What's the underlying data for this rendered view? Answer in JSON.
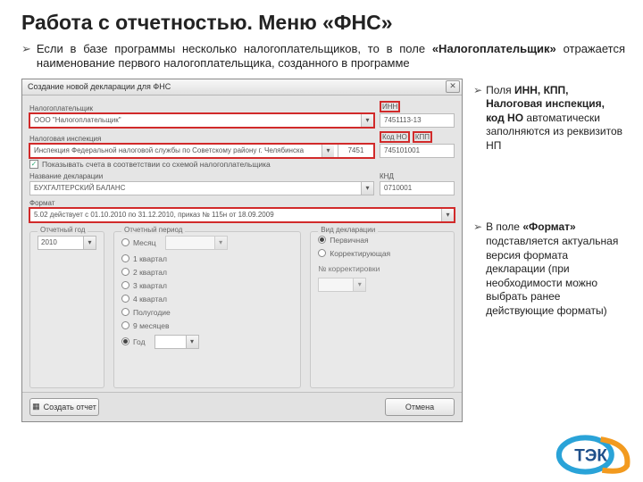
{
  "title": "Работа с отчетностью. Меню «ФНС»",
  "top_bullet_prefix": "Если в базе программы несколько налогоплательщиков, то в поле ",
  "top_bullet_bold": "«Налогоплательщик»",
  "top_bullet_suffix": " отражается наименование первого налогоплательщика, созданного в программе",
  "side": {
    "note1_prefix": "Поля ",
    "note1_bold": "ИНН, КПП, Налоговая инспекция, код НО",
    "note1_suffix": " автоматически заполняются из реквизитов НП",
    "note2_prefix": "В поле ",
    "note2_bold": "«Формат»",
    "note2_suffix": " подставляется актуальная версия формата декларации (при необходимости можно выбрать ранее действующие форматы)"
  },
  "dialog": {
    "title": "Создание новой декларации для ФНС",
    "close": "✕",
    "labels": {
      "taxpayer": "Налогоплательщик",
      "tax_office": "Налоговая инспекция",
      "doc_name": "Название декларации",
      "format": "Формат",
      "inn": "ИНН",
      "code_no": "Код НО",
      "kpp": "КПП",
      "knd": "КНД",
      "report_year": "Отчетный год",
      "report_period": "Отчетный период",
      "decl_kind": "Вид декларации"
    },
    "values": {
      "taxpayer": "ООО \"Налогоплательщик\"",
      "tax_office_combined": "Инспекция Федеральной налоговой службы по Советскому району г. Челябинска",
      "code_no_val": "7451",
      "inn": "7451113-13",
      "kpp": "745101001",
      "doc_name": "БУХГАЛТЕРСКИЙ БАЛАНС",
      "knd": "0710001",
      "format": "5.02 действует с 01.10.2010 по 31.12.2010, приказ № 115н от 18.09.2009",
      "year": "2010"
    },
    "checkbox": "Показывать счета в соответствии со схемой налогоплательщика",
    "periods": [
      "Месяц",
      "1 квартал",
      "2 квартал",
      "3 квартал",
      "4 квартал",
      "Полугодие",
      "9 месяцев",
      "Год"
    ],
    "period_selected": 7,
    "kinds": {
      "primary": "Первичная",
      "correcting": "Корректирующая",
      "corr_num": "№ корректировки"
    },
    "buttons": {
      "create": "Создать отчет",
      "cancel": "Отмена"
    }
  }
}
